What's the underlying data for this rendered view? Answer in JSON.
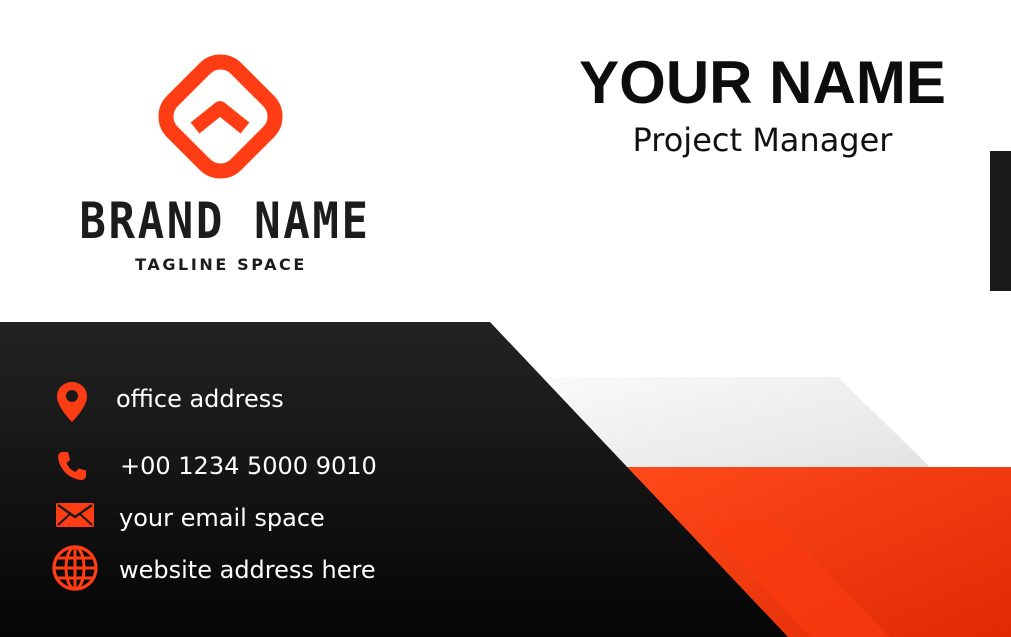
{
  "card": {
    "brand": {
      "name": "BRAND NAME",
      "tagline": "TAGLINE SPACE"
    },
    "person": {
      "name": "YOUR NAME",
      "title": "Project Manager"
    },
    "contacts": {
      "address": {
        "icon": "location-pin-icon",
        "text": "office address"
      },
      "phone": {
        "icon": "phone-icon",
        "text": "+00 1234 5000 9010"
      },
      "email": {
        "icon": "envelope-icon",
        "text": "your email space"
      },
      "website": {
        "icon": "globe-icon",
        "text": "website address here"
      }
    },
    "colors": {
      "accent": "#ff3d14",
      "dark": "#111111",
      "light_gray": "#eeeeee",
      "text_light": "#ffffff",
      "text_dark": "#111111"
    }
  }
}
